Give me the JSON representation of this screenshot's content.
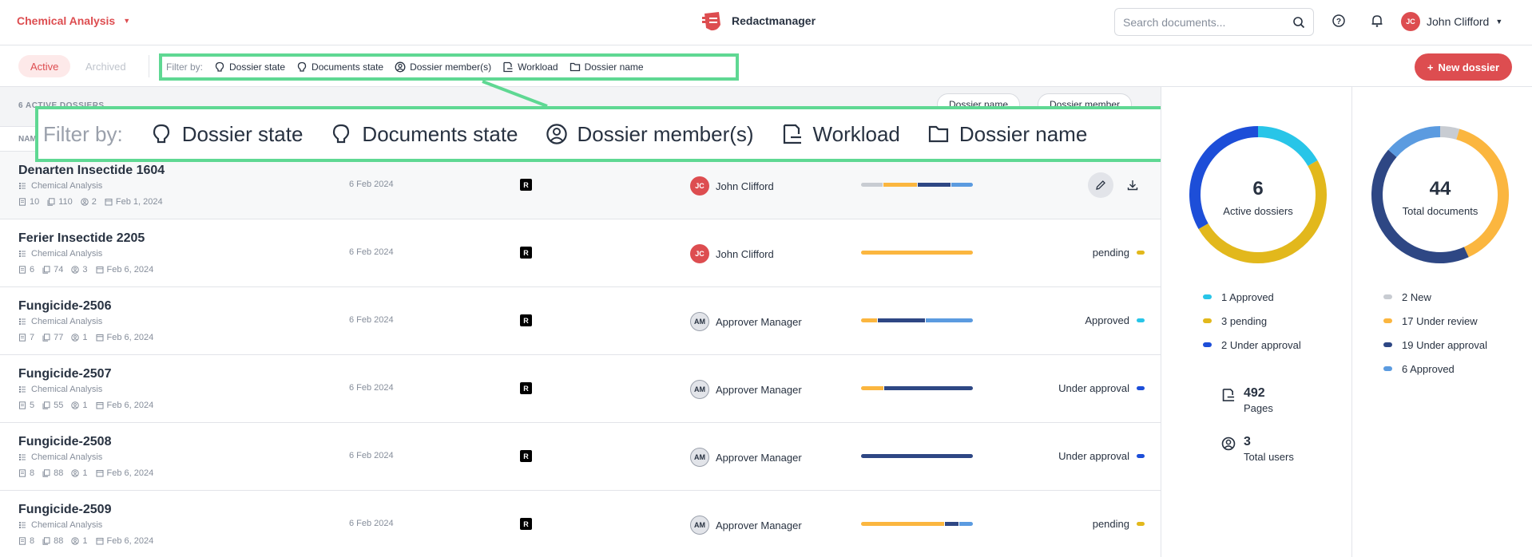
{
  "header": {
    "project": "Chemical Analysis",
    "brand": "Redactmanager",
    "search_placeholder": "Search documents...",
    "user": {
      "initials": "JC",
      "name": "John Clifford"
    }
  },
  "filterbar": {
    "tab_active": "Active",
    "tab_archived": "Archived",
    "filter_label": "Filter by:",
    "filters": [
      "Dossier state",
      "Documents state",
      "Dossier member(s)",
      "Workload",
      "Dossier name"
    ],
    "new_dossier": "New dossier"
  },
  "list": {
    "count_label": "6 ACTIVE DOSSIERS",
    "sort_a": "Dossier name",
    "sort_b": "Dossier member",
    "col_name": "NAME",
    "rows": [
      {
        "name": "Denarten Insectide 1604",
        "template": "Chemical Analysis",
        "docs": "10",
        "pages": "110",
        "members": "2",
        "created": "Feb 1, 2024",
        "date": "6 Feb 2024",
        "badge": "R",
        "owner_initials": "JC",
        "owner": "John Clifford",
        "status": "",
        "status_color": ""
      },
      {
        "name": "Ferier Insectide 2205",
        "template": "Chemical Analysis",
        "docs": "6",
        "pages": "74",
        "members": "3",
        "created": "Feb 6, 2024",
        "date": "6 Feb 2024",
        "badge": "R",
        "owner_initials": "JC",
        "owner": "John Clifford",
        "status": "pending",
        "status_color": "#e2b81c"
      },
      {
        "name": "Fungicide-2506",
        "template": "Chemical Analysis",
        "docs": "7",
        "pages": "77",
        "members": "1",
        "created": "Feb 6, 2024",
        "date": "6 Feb 2024",
        "badge": "R",
        "owner_initials": "AM",
        "owner": "Approver Manager",
        "status": "Approved",
        "status_color": "#28c5e8"
      },
      {
        "name": "Fungicide-2507",
        "template": "Chemical Analysis",
        "docs": "5",
        "pages": "55",
        "members": "1",
        "created": "Feb 6, 2024",
        "date": "6 Feb 2024",
        "badge": "R",
        "owner_initials": "AM",
        "owner": "Approver Manager",
        "status": "Under approval",
        "status_color": "#1d4ed8"
      },
      {
        "name": "Fungicide-2508",
        "template": "Chemical Analysis",
        "docs": "8",
        "pages": "88",
        "members": "1",
        "created": "Feb 6, 2024",
        "date": "6 Feb 2024",
        "badge": "R",
        "owner_initials": "AM",
        "owner": "Approver Manager",
        "status": "Under approval",
        "status_color": "#1d4ed8"
      },
      {
        "name": "Fungicide-2509",
        "template": "Chemical Analysis",
        "docs": "8",
        "pages": "88",
        "members": "1",
        "created": "Feb 6, 2024",
        "date": "6 Feb 2024",
        "badge": "R",
        "owner_initials": "AM",
        "owner": "Approver Manager",
        "status": "pending",
        "status_color": "#e2b81c"
      }
    ]
  },
  "workload_colors": {
    "new": "#c8ccd2",
    "review": "#fbb63f",
    "approval": "#2e4784",
    "approved": "#5b9be0"
  },
  "workload": [
    {
      "new": 2,
      "review": 3,
      "approval": 3,
      "approved": 2
    },
    {
      "new": 0,
      "review": 6,
      "approval": 0,
      "approved": 0
    },
    {
      "new": 0,
      "review": 1,
      "approval": 3,
      "approved": 3
    },
    {
      "new": 0,
      "review": 1,
      "approval": 4,
      "approved": 0
    },
    {
      "new": 0,
      "review": 0,
      "approval": 8,
      "approved": 0
    },
    {
      "new": 0,
      "review": 6,
      "approval": 1,
      "approved": 1
    }
  ],
  "stats": {
    "dossiers": {
      "total": "6",
      "label": "Active dossiers",
      "segments": [
        {
          "label": "1 Approved",
          "value": 1,
          "color": "#28c5e8"
        },
        {
          "label": "3 pending",
          "value": 3,
          "color": "#e2b81c"
        },
        {
          "label": "2 Under approval",
          "value": 2,
          "color": "#1d4ed8"
        }
      ]
    },
    "documents": {
      "total": "44",
      "label": "Total documents",
      "segments": [
        {
          "label": "2 New",
          "value": 2,
          "color": "#c8ccd2"
        },
        {
          "label": "17 Under review",
          "value": 17,
          "color": "#fbb63f"
        },
        {
          "label": "19 Under approval",
          "value": 19,
          "color": "#2e4784"
        },
        {
          "label": "6 Approved",
          "value": 6,
          "color": "#5b9be0"
        }
      ]
    },
    "pages": "492",
    "pages_label": "Pages",
    "users": "3",
    "users_label": "Total users"
  }
}
